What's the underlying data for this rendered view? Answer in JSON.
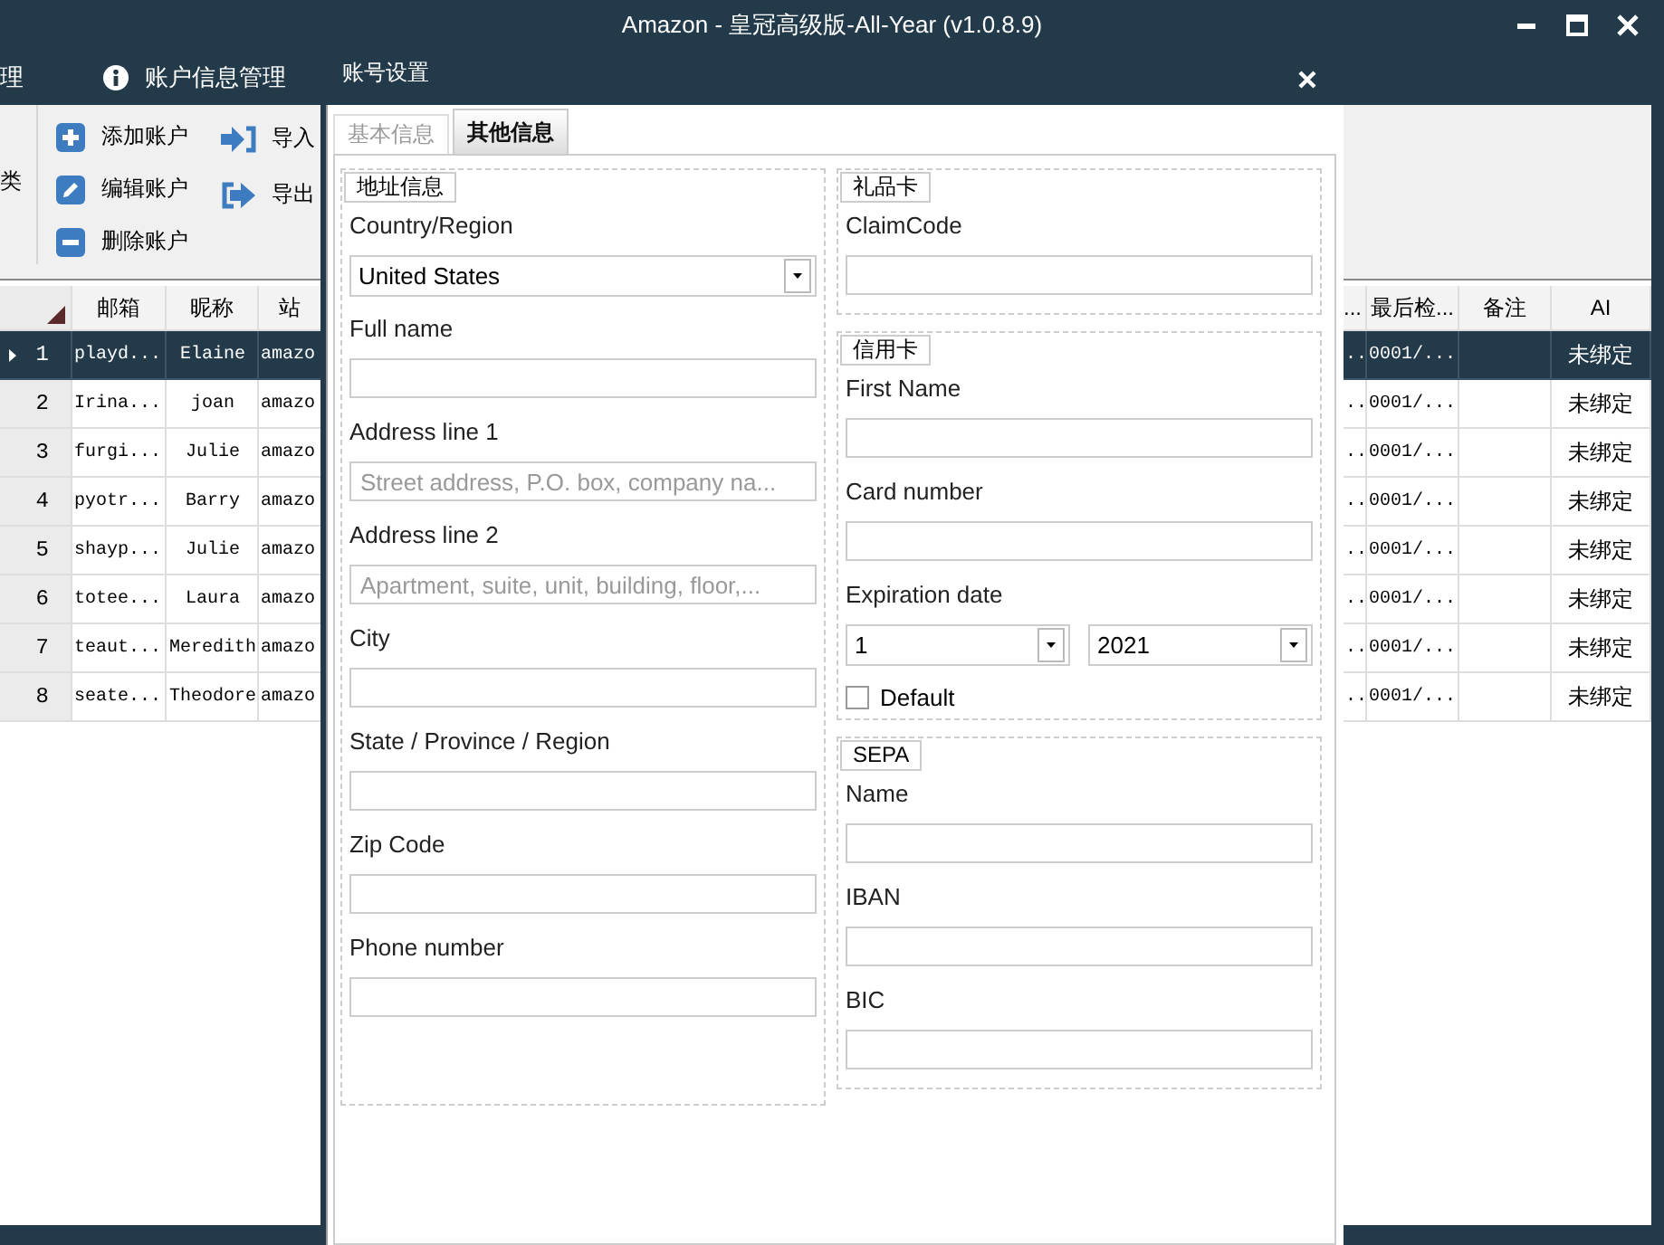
{
  "window": {
    "title": "Amazon - 皇冠高级版-All-Year  (v1.0.8.9)"
  },
  "nav": [
    {
      "label": "理",
      "kind": "plain"
    },
    {
      "label": "账户信息管理",
      "kind": "info"
    },
    {
      "kind": "partial"
    }
  ],
  "toolbar": {
    "group_label": "类",
    "actions": [
      {
        "label": "添加账户",
        "kind": "add"
      },
      {
        "label": "编辑账户",
        "kind": "edit"
      },
      {
        "label": "删除账户",
        "kind": "delete"
      }
    ],
    "transfer": [
      {
        "label": "导入",
        "kind": "import"
      },
      {
        "label": "导出",
        "kind": "export"
      }
    ]
  },
  "table": {
    "left_columns": [
      "邮箱",
      "昵称",
      "站"
    ],
    "right_columns": [
      "...",
      "最后检...",
      "备注",
      "AI"
    ],
    "rows": [
      {
        "index": "1",
        "email": "playd...",
        "nickname": "Elaine",
        "site": "amazo",
        "column_x": "..",
        "last_check": "0001/...",
        "ai": "未绑定",
        "selected": true
      },
      {
        "index": "2",
        "email": "Irina...",
        "nickname": "joan",
        "site": "amazo",
        "column_x": "..",
        "last_check": "0001/...",
        "ai": "未绑定",
        "selected": false
      },
      {
        "index": "3",
        "email": "furgi...",
        "nickname": "Julie",
        "site": "amazo",
        "column_x": "..",
        "last_check": "0001/...",
        "ai": "未绑定",
        "selected": false
      },
      {
        "index": "4",
        "email": "pyotr...",
        "nickname": "Barry",
        "site": "amazo",
        "column_x": "..",
        "last_check": "0001/...",
        "ai": "未绑定",
        "selected": false
      },
      {
        "index": "5",
        "email": "shayp...",
        "nickname": "Julie",
        "site": "amazo",
        "column_x": "..",
        "last_check": "0001/...",
        "ai": "未绑定",
        "selected": false
      },
      {
        "index": "6",
        "email": "totee...",
        "nickname": "Laura",
        "site": "amazo",
        "column_x": "..",
        "last_check": "0001/...",
        "ai": "未绑定",
        "selected": false
      },
      {
        "index": "7",
        "email": "teaut...",
        "nickname": "Meredith",
        "site": "amazo",
        "column_x": "..",
        "last_check": "0001/...",
        "ai": "未绑定",
        "selected": false
      },
      {
        "index": "8",
        "email": "seate...",
        "nickname": "Theodore",
        "site": "amazo",
        "column_x": "..",
        "last_check": "0001/...",
        "ai": "未绑定",
        "selected": false
      }
    ]
  },
  "dialog": {
    "title": "账号设置",
    "tabs": [
      {
        "label": "基本信息",
        "selected": false
      },
      {
        "label": "其他信息",
        "selected": true
      }
    ],
    "address": {
      "legend": "地址信息",
      "fields": [
        {
          "kind": "select",
          "label": "Country/Region",
          "value": "United States"
        },
        {
          "kind": "text",
          "label": "Full name"
        },
        {
          "kind": "text",
          "label": "Address line 1",
          "placeholder": "Street address, P.O. box, company na..."
        },
        {
          "kind": "text",
          "label": "Address line 2",
          "placeholder": "Apartment, suite, unit, building, floor,..."
        },
        {
          "kind": "text",
          "label": "City"
        },
        {
          "kind": "text",
          "label": "State / Province / Region"
        },
        {
          "kind": "text",
          "label": "Zip Code"
        },
        {
          "kind": "text",
          "label": "Phone number"
        }
      ]
    },
    "gift_card": {
      "legend": "礼品卡",
      "fields": [
        {
          "kind": "text",
          "label": "ClaimCode"
        }
      ]
    },
    "credit_card": {
      "legend": "信用卡",
      "fields": [
        {
          "kind": "text",
          "label": "First Name"
        },
        {
          "kind": "text",
          "label": "Card number"
        }
      ],
      "expiration": {
        "label": "Expiration date",
        "month": "1",
        "year": "2021"
      },
      "default": {
        "label": "Default",
        "checked": false
      }
    },
    "sepa": {
      "legend": "SEPA",
      "fields": [
        {
          "kind": "text",
          "label": "Name"
        },
        {
          "kind": "text",
          "label": "IBAN"
        },
        {
          "kind": "text",
          "label": "BIC"
        }
      ]
    }
  }
}
